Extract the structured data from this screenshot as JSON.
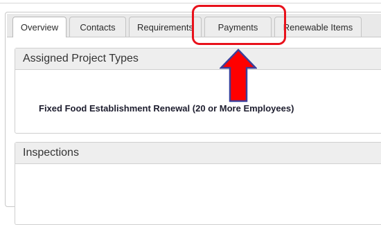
{
  "tabs": [
    {
      "label": "Overview",
      "active": true
    },
    {
      "label": "Contacts",
      "active": false
    },
    {
      "label": "Requirements",
      "active": false
    },
    {
      "label": "Payments",
      "active": false
    },
    {
      "label": "Renewable Items",
      "active": false
    }
  ],
  "assigned_project_types": {
    "header": "Assigned Project Types",
    "items": [
      "Fixed Food Establishment Renewal (20 or More Employees)"
    ]
  },
  "inspections": {
    "header": "Inspections"
  },
  "annotation": {
    "highlight_color": "#e8111b",
    "arrow_fill": "#ff0000",
    "arrow_outline": "#3b3f9a",
    "arrow_icon": "up-arrow-icon"
  }
}
